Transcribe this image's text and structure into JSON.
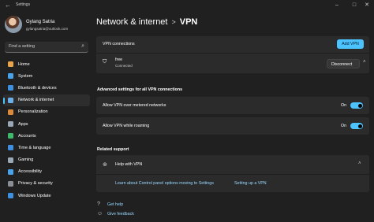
{
  "window": {
    "title": "Settings",
    "back_icon": "back-arrow-icon"
  },
  "user": {
    "name": "Gylang Satria",
    "email": "gylangsatria@outlook.com"
  },
  "search": {
    "placeholder": "Find a setting"
  },
  "sidebar": {
    "items": [
      {
        "label": "Home",
        "icon": "home-icon",
        "color": "#e8a44a"
      },
      {
        "label": "System",
        "icon": "monitor-icon",
        "color": "#4aa3e8"
      },
      {
        "label": "Bluetooth & devices",
        "icon": "bluetooth-icon",
        "color": "#3f8fe0"
      },
      {
        "label": "Network & internet",
        "icon": "wifi-icon",
        "color": "#6bb0e8",
        "active": true
      },
      {
        "label": "Personalization",
        "icon": "brush-icon",
        "color": "#d98a3a"
      },
      {
        "label": "Apps",
        "icon": "apps-icon",
        "color": "#9aa7b5"
      },
      {
        "label": "Accounts",
        "icon": "person-icon",
        "color": "#3fb86b"
      },
      {
        "label": "Time & language",
        "icon": "globe-clock-icon",
        "color": "#3f8fe0"
      },
      {
        "label": "Gaming",
        "icon": "controller-icon",
        "color": "#9aa7b5"
      },
      {
        "label": "Accessibility",
        "icon": "accessibility-icon",
        "color": "#4aa3e8"
      },
      {
        "label": "Privacy & security",
        "icon": "shield-icon",
        "color": "#8a8f96"
      },
      {
        "label": "Windows Update",
        "icon": "update-icon",
        "color": "#3f8fe0"
      }
    ]
  },
  "breadcrumb": {
    "parent": "Network & internet",
    "separator": ">",
    "current": "VPN"
  },
  "vpn": {
    "connections_label": "VPN connections",
    "add_button": "Add VPN",
    "connection": {
      "name": "free",
      "status": "Connected",
      "button": "Disconnect"
    }
  },
  "advanced": {
    "heading": "Advanced settings for all VPN connections",
    "rows": [
      {
        "label": "Allow VPN over metered networks",
        "state": "On",
        "on": true
      },
      {
        "label": "Allow VPN while roaming",
        "state": "On",
        "on": true
      }
    ]
  },
  "support": {
    "heading": "Related support",
    "title": "Help with VPN",
    "links": [
      "Learn about Control panel options moving to Settings",
      "Setting up a VPN"
    ]
  },
  "footer": {
    "get_help": "Get help",
    "give_feedback": "Give feedback"
  },
  "colors": {
    "accent": "#4cc2ff",
    "background": "#202020",
    "card": "#2b2b2b"
  }
}
